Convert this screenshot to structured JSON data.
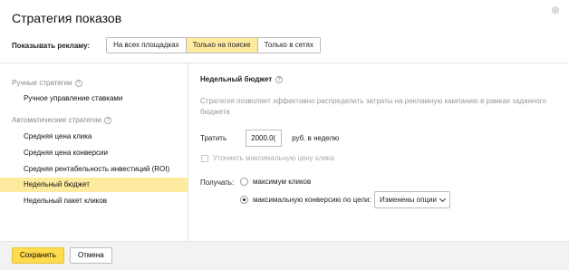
{
  "dialog": {
    "title": "Стратегия показов"
  },
  "show": {
    "label": "Показывать рекламу:",
    "options": [
      "На всех площадках",
      "Только на поиске",
      "Только в сетях"
    ],
    "selected": "Только на поиске"
  },
  "sidebar": {
    "manual_group": "Ручные стратегии",
    "manual_items": [
      "Ручное управление ставками"
    ],
    "auto_group": "Автоматические стратегии",
    "auto_items": [
      "Средняя цена клика",
      "Средняя цена конверсии",
      "Средняя рентабельность инвестиций (ROI)",
      "Недельный бюджет",
      "Недельный пакет кликов"
    ],
    "selected": "Недельный бюджет"
  },
  "main": {
    "title": "Недельный бюджет",
    "description": "Стратегия позволяет эффективно распределить затраты на рекламную кампанию в рамках заданного бюджета",
    "spend_label": "Тратить",
    "spend_value": "2000.0(",
    "spend_unit": "руб. в неделю",
    "refine_label": "Уточнить максимальную цену клика",
    "get_label": "Получать:",
    "radio_max_clicks": "максимум кликов",
    "radio_max_conv": "максимальную конверсию по цели:",
    "select_value": "Изменены опции"
  },
  "footer": {
    "save": "Сохранить",
    "cancel": "Отмена"
  },
  "colors": {
    "accent": "#ffeba0",
    "primary_button": "#ffdb4d"
  },
  "icons": {
    "close": "close-icon",
    "help": "help-icon",
    "chevron": "chevron-down-icon"
  }
}
